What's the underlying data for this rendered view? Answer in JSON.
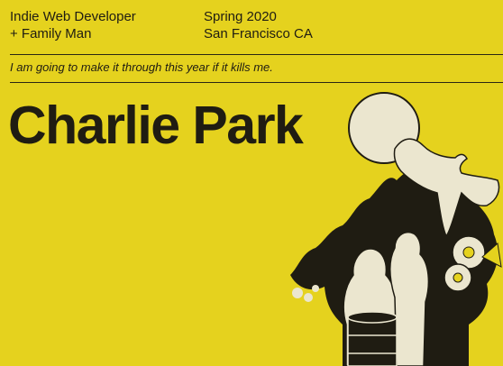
{
  "header": {
    "role_line1": "Indie Web Developer",
    "role_line2": "+ Family Man",
    "season": "Spring 2020",
    "location": "San Francisco CA"
  },
  "tagline": "I am going to make it through this year if it kills me.",
  "title": "Charlie Park",
  "colors": {
    "background": "#e5d21e",
    "ink": "#1f1c12",
    "cream": "#ebe6cf"
  },
  "illustration": {
    "icon": "moon-bird-figures-illustration"
  }
}
